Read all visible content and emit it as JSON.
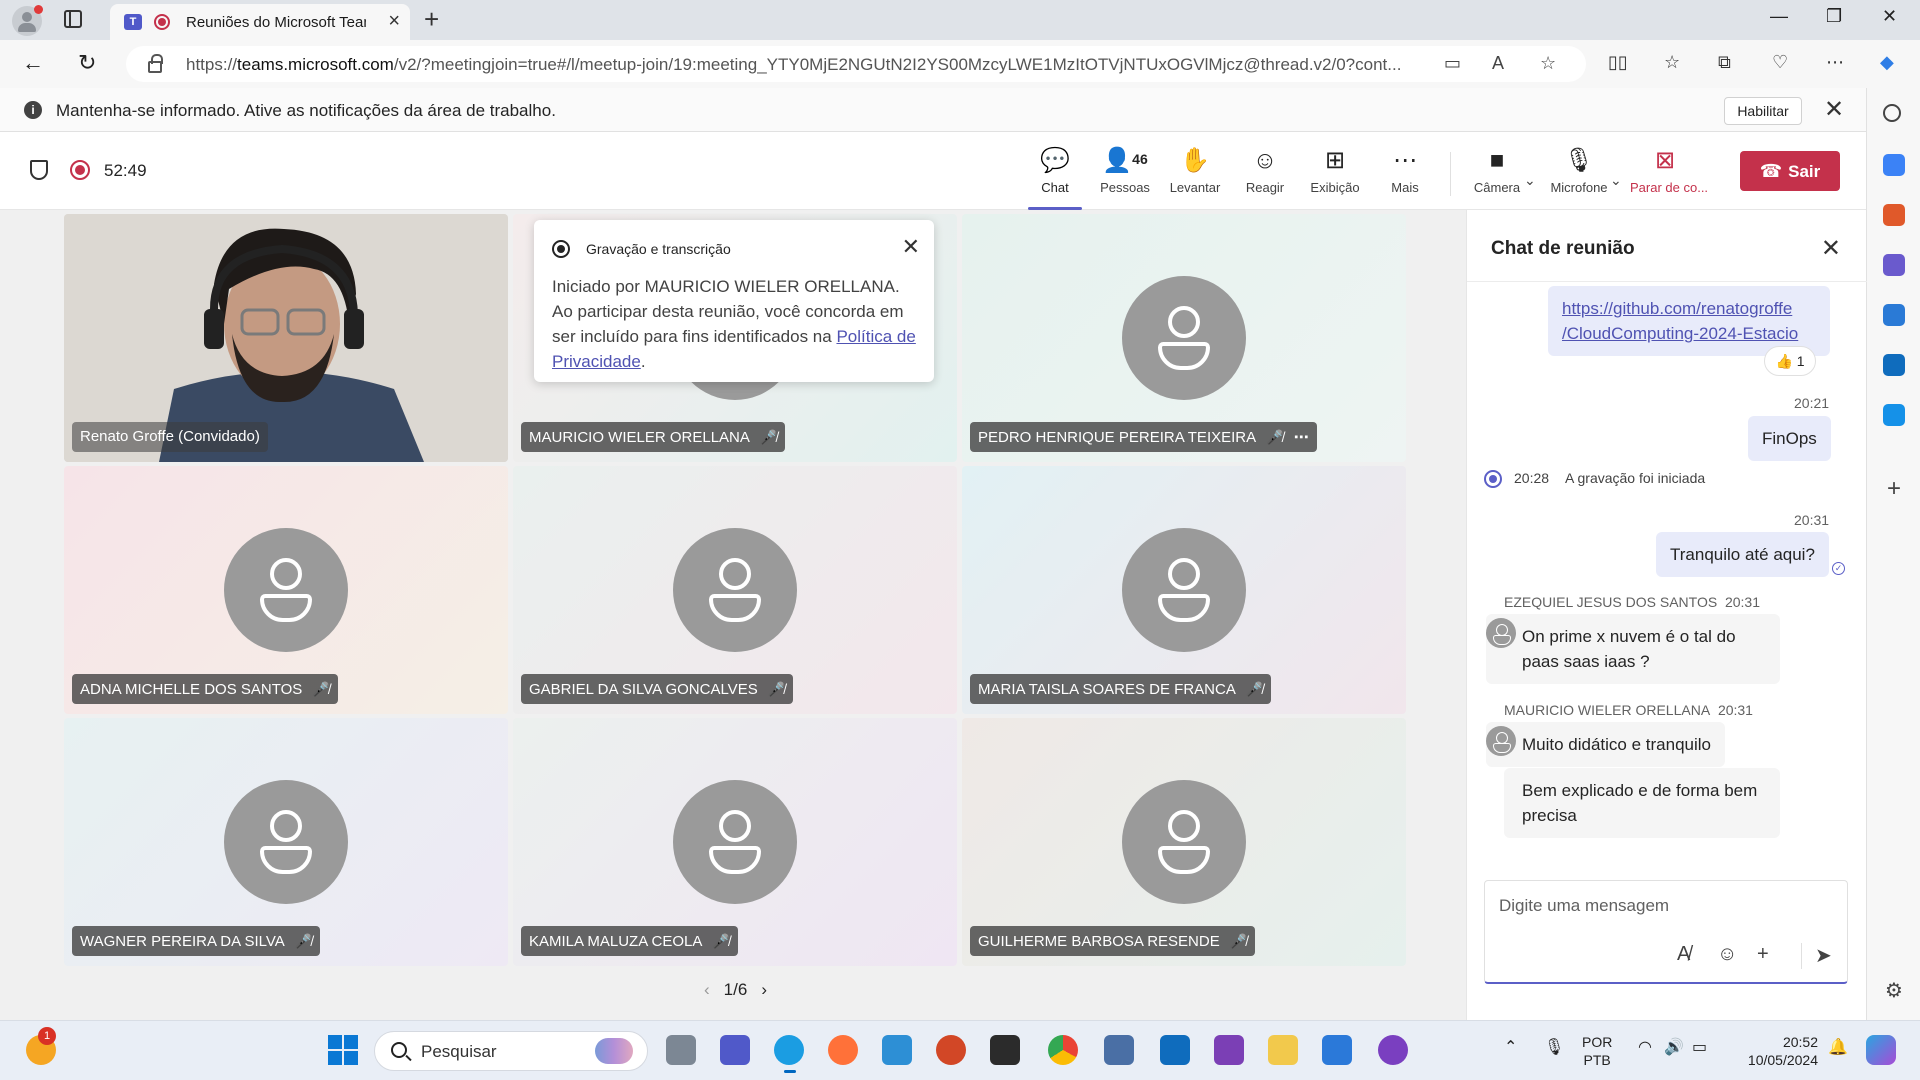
{
  "browser": {
    "tab_title": "Reuniões do Microsoft Teams",
    "url_prefix": "https://",
    "url_host": "teams.microsoft.com",
    "url_rest": "/v2/?meetingjoin=true#/l/meetup-join/19:meeting_YTY0MjE2NGUtN2I2YS00MzcyLWE1MzItOTVjNTUxOGVlMjcz@thread.v2/0?cont..."
  },
  "banner": {
    "message": "Mantenha-se informado. Ative as notificações da área de trabalho.",
    "enable_label": "Habilitar"
  },
  "meeting": {
    "timer": "52:49",
    "toolbar": {
      "chat": "Chat",
      "people": "Pessoas",
      "people_count": "46",
      "raise": "Levantar",
      "react": "Reagir",
      "view": "Exibição",
      "more": "Mais",
      "camera": "Câmera",
      "mic": "Microfone",
      "stop_share": "Parar de co...",
      "leave": "Sair"
    },
    "accent_color": "#5b5fc7",
    "leave_color": "#c4314b"
  },
  "popup": {
    "title": "Gravação e transcrição",
    "body": "Iniciado por MAURICIO WIELER ORELLANA. Ao participar desta reunião, você concorda em ser incluído para fins identificados na ",
    "link": "Política de Privacidade",
    "tail": "."
  },
  "participants": [
    {
      "name": "Renato Groffe (Convidado)"
    },
    {
      "name": "MAURICIO WIELER ORELLANA"
    },
    {
      "name": "PEDRO HENRIQUE PEREIRA TEIXEIRA"
    },
    {
      "name": "ADNA MICHELLE DOS SANTOS"
    },
    {
      "name": "GABRIEL DA SILVA GONCALVES"
    },
    {
      "name": "MARIA TAISLA SOARES DE FRANCA"
    },
    {
      "name": "WAGNER PEREIRA DA SILVA"
    },
    {
      "name": "KAMILA MALUZA CEOLA"
    },
    {
      "name": "GUILHERME BARBOSA RESENDE"
    }
  ],
  "pager": "1/6",
  "chat": {
    "title": "Chat de reunião",
    "link_line1": "https://github.com/renatogroffe",
    "link_line2": "/CloudComputing-2024-Estacio",
    "reaction": "👍 1",
    "msg1_time": "20:21",
    "msg1": "FinOps",
    "sys_time": "20:28",
    "sys_text": "A gravação foi iniciada",
    "msg2_time": "20:31",
    "msg2": "Tranquilo até aqui?",
    "sender1": "EZEQUIEL JESUS DOS SANTOS",
    "sender1_time": "20:31",
    "sender1_msg": "On prime x nuvem é o tal do paas saas iaas ?",
    "sender2": "MAURICIO WIELER ORELLANA",
    "sender2_time": "20:31",
    "sender2_msg1": "Muito didático e tranquilo",
    "sender2_msg2": "Bem explicado e  de forma bem precisa",
    "composer_placeholder": "Digite uma mensagem"
  },
  "taskbar": {
    "search_placeholder": "Pesquisar",
    "lang1": "POR",
    "lang2": "PTB",
    "time": "20:52",
    "date": "10/05/2024",
    "notif_count": "1"
  }
}
